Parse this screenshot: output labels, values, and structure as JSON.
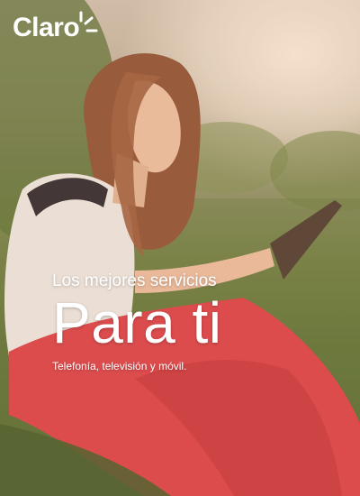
{
  "brand": {
    "logo_text": "Claro",
    "accent_color": "#ef3829"
  },
  "hero": {
    "subtitle": "Los mejores servicios",
    "headline": "Para ti",
    "tagline": "Telefonía, televisión y móvil."
  },
  "photo": {
    "subject": "woman-with-tablet-in-park-photo"
  }
}
